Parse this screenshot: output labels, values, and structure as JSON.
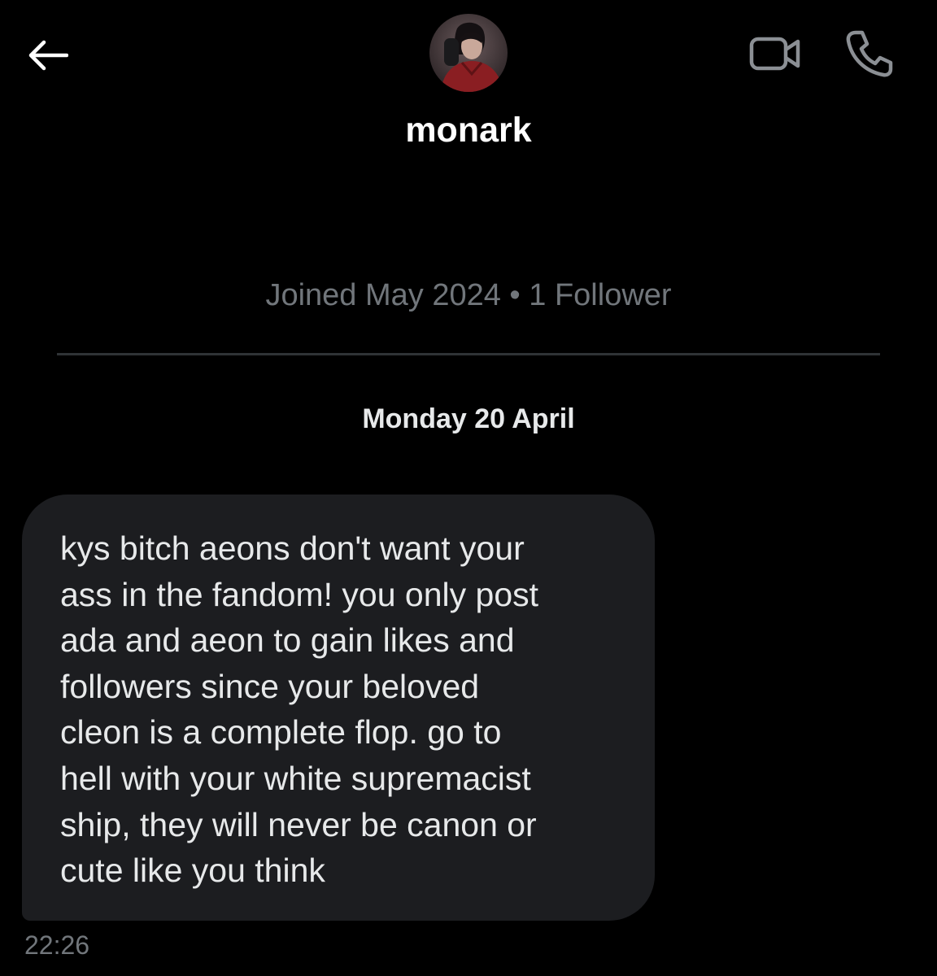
{
  "header": {
    "back_icon": "arrow-left-icon",
    "video_icon": "video-camera-icon",
    "phone_icon": "phone-icon",
    "icon_color": "#8b8f94"
  },
  "profile": {
    "display_name": "monark",
    "meta": "Joined May 2024 • 1 Follower"
  },
  "conversation": {
    "date_label": "Monday 20 April",
    "messages": [
      {
        "text": "kys bitch aeons don't want your\nass in the fandom! you only post\nada and aeon to gain likes and\nfollowers since your beloved\ncleon is a complete flop. go to\nhell with your white supremacist\nship, they will never be canon or\ncute like you think",
        "time": "22:26"
      }
    ]
  },
  "colors": {
    "background": "#000000",
    "bubble": "#1c1d20",
    "primary_text": "#e7e9ea",
    "secondary_text": "#71767b",
    "divider": "#2f3336"
  }
}
